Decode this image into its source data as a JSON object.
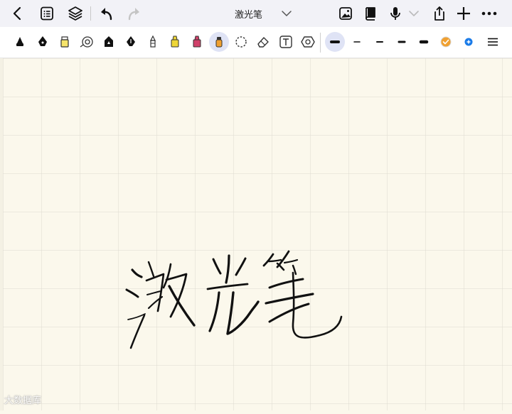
{
  "app": {
    "title": "激光笔",
    "watermark": "大数据库"
  },
  "topbar": {
    "left_icons": [
      "back-chevron-icon",
      "document-list-icon",
      "layers-icon",
      "undo-icon",
      "redo-icon"
    ],
    "right_icons": [
      "image-icon",
      "book-icon",
      "microphone-icon",
      "chevron-down-icon",
      "share-icon",
      "add-icon",
      "more-icon"
    ]
  },
  "toolbar": {
    "tools": [
      "fountain-pen",
      "brush-pen",
      "highlighter-yellow",
      "lasso-magnifier",
      "ballpoint-pen",
      "calligraphy-pen",
      "pencil",
      "marker-yellow",
      "marker-pink",
      "laser-pointer",
      "lasso-select",
      "eraser",
      "text-tool",
      "shape-tool"
    ],
    "selected_tool": "laser-pointer",
    "stroke_widths": [
      "extra-thin",
      "thin",
      "medium",
      "thick",
      "extra-thick"
    ],
    "selected_width": "extra-thin",
    "colors": {
      "primary": "#f0a030",
      "add": "#1a7be8"
    }
  },
  "canvas": {
    "background": "#fbf8ec",
    "grid_color": "#dedad0",
    "handwriting": "激光笔"
  }
}
